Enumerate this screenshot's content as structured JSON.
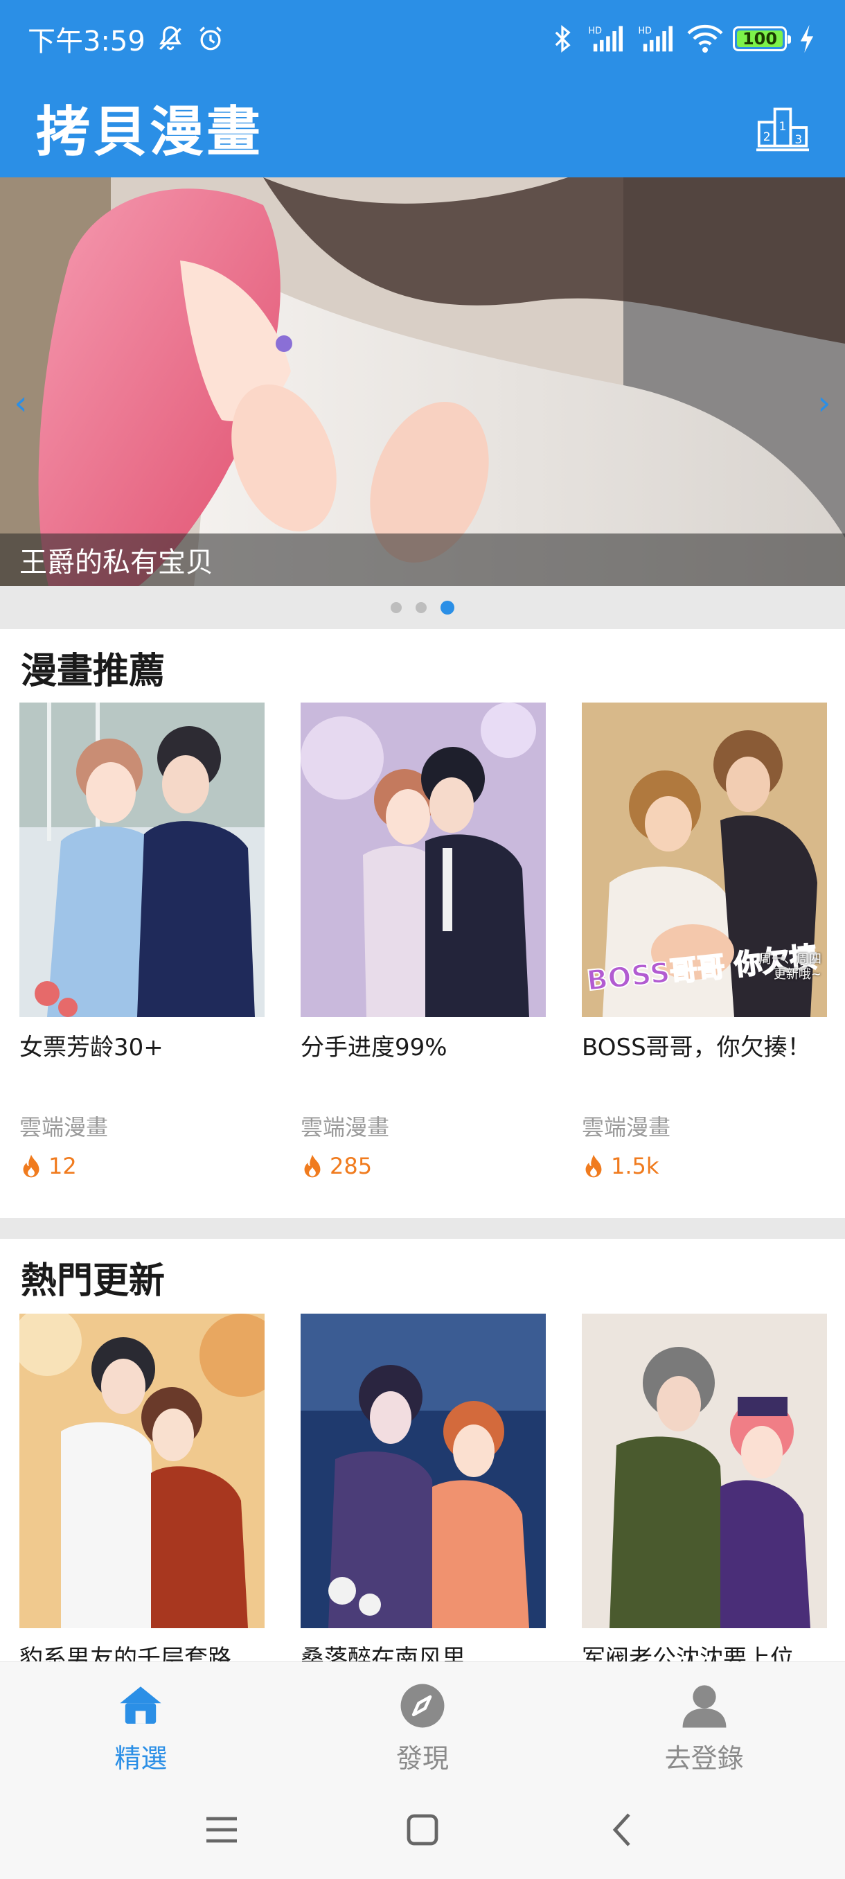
{
  "status_bar": {
    "time": "下午3:59",
    "battery": "100",
    "battery_level": 1.0
  },
  "header": {
    "title": "拷貝漫畫",
    "rank_icon": "ranking-podium-icon"
  },
  "banner": {
    "caption": "王爵的私有宝贝",
    "dots_total": 3,
    "active_dot": 3
  },
  "sections": [
    {
      "title": "漫畫推薦",
      "items": [
        {
          "title": "女票芳龄30+",
          "author": "雲端漫畫",
          "heat": "12"
        },
        {
          "title": "分手进度99%",
          "author": "雲端漫畫",
          "heat": "285"
        },
        {
          "title": "BOSS哥哥，你欠揍！",
          "author": "雲端漫畫",
          "heat": "1.5k"
        }
      ]
    },
    {
      "title": "熱門更新",
      "items": [
        {
          "title": "豹系男友的千层套路"
        },
        {
          "title": "桑落醉在南风里"
        },
        {
          "title": "军阀老公沈沈要上位"
        }
      ]
    }
  ],
  "cover_text": {
    "boss_logo": "BOSS哥哥 你欠揍",
    "boss_schedule": "周一、周四 更新哦~"
  },
  "bottom_nav": [
    {
      "label": "精選",
      "icon": "home-icon",
      "active": true
    },
    {
      "label": "發現",
      "icon": "compass-icon",
      "active": false
    },
    {
      "label": "去登錄",
      "icon": "user-icon",
      "active": false
    }
  ],
  "colors": {
    "primary": "#2b8fe6",
    "heat": "#f07b1e",
    "muted": "#9a9a9a",
    "strip": "#e8e8e8"
  }
}
